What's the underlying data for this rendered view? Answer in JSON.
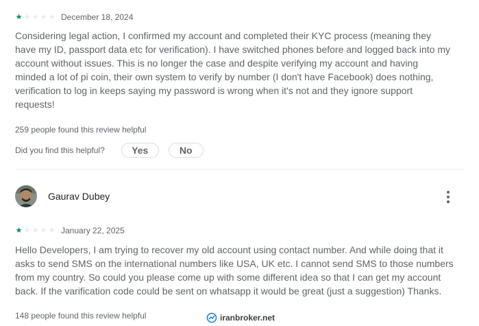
{
  "review1": {
    "rating": 1,
    "date": "December 18, 2024",
    "lines": [
      "Considering legal action, I confirmed my account and completed their KYC process (meaning they",
      "have my ID, passport data etc for verification). I have switched phones before and logged back into my",
      "account without issues. This is no longer the case and despite verifying my account and having",
      "minded a lot of pi coin, their own system to verify by number (I don't have Facebook) does nothing,",
      "verification to log in keeps saying my password is wrong when it's not and they ignore support",
      "requests!"
    ],
    "helpful_count": "259 people found this review helpful",
    "helpful_question": "Did you find this helpful?",
    "yes_label": "Yes",
    "no_label": "No"
  },
  "review2": {
    "author": "Gaurav Dubey",
    "rating": 1,
    "date": "January 22, 2025",
    "lines": [
      "Hello Developers, I am trying to recover my old account using contact number. And while doing that it",
      "asks to send SMS on the international numbers like USA, UK etc. I cannot send SMS to those numbers",
      "from my country. So could you please come up with some different idea so that I can get my account",
      "back. If the varification code could be sent on whatsapp it would be great (just a suggestion) Thanks."
    ],
    "helpful_count": "148 people found this review helpful"
  },
  "watermark": {
    "text": "iranbroker.net"
  },
  "colors": {
    "star_filled": "#01875f",
    "star_empty": "#e8eaed",
    "text": "#5f6368"
  }
}
